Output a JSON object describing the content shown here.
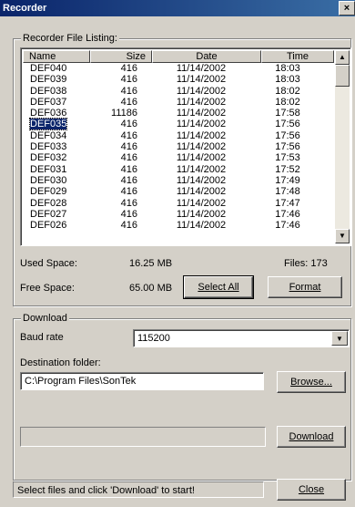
{
  "window": {
    "title": "Recorder",
    "close_glyph": "×"
  },
  "listing": {
    "group_label": "Recorder File Listing:",
    "columns": [
      "Name",
      "Size",
      "Date",
      "Time"
    ],
    "rows": [
      {
        "name": "DEF040",
        "size": "416",
        "date": "11/14/2002",
        "time": "18:03"
      },
      {
        "name": "DEF039",
        "size": "416",
        "date": "11/14/2002",
        "time": "18:03"
      },
      {
        "name": "DEF038",
        "size": "416",
        "date": "11/14/2002",
        "time": "18:02"
      },
      {
        "name": "DEF037",
        "size": "416",
        "date": "11/14/2002",
        "time": "18:02"
      },
      {
        "name": "DEF036",
        "size": "11186",
        "date": "11/14/2002",
        "time": "17:58"
      },
      {
        "name": "DEF035",
        "size": "416",
        "date": "11/14/2002",
        "time": "17:56"
      },
      {
        "name": "DEF034",
        "size": "416",
        "date": "11/14/2002",
        "time": "17:56"
      },
      {
        "name": "DEF033",
        "size": "416",
        "date": "11/14/2002",
        "time": "17:56"
      },
      {
        "name": "DEF032",
        "size": "416",
        "date": "11/14/2002",
        "time": "17:53"
      },
      {
        "name": "DEF031",
        "size": "416",
        "date": "11/14/2002",
        "time": "17:52"
      },
      {
        "name": "DEF030",
        "size": "416",
        "date": "11/14/2002",
        "time": "17:49"
      },
      {
        "name": "DEF029",
        "size": "416",
        "date": "11/14/2002",
        "time": "17:48"
      },
      {
        "name": "DEF028",
        "size": "416",
        "date": "11/14/2002",
        "time": "17:47"
      },
      {
        "name": "DEF027",
        "size": "416",
        "date": "11/14/2002",
        "time": "17:46"
      },
      {
        "name": "DEF026",
        "size": "416",
        "date": "11/14/2002",
        "time": "17:46"
      }
    ],
    "selected_row": "DEF035",
    "scroll_up_glyph": "▲",
    "scroll_down_glyph": "▼",
    "used_space_label": "Used Space:",
    "used_space_value": "16.25 MB",
    "files_label": "Files: 173",
    "free_space_label": "Free Space:",
    "free_space_value": "65.00 MB",
    "select_all_label": "Select All",
    "format_label": "Format"
  },
  "download": {
    "group_label": "Download",
    "baud_label": "Baud rate",
    "baud_value": "115200",
    "dropdown_glyph": "▼",
    "dest_label": "Destination folder:",
    "dest_value": "C:\\Program Files\\SonTek",
    "browse_label": "Browse...",
    "download_label": "Download"
  },
  "footer": {
    "status_text": "Select files and click 'Download' to start!",
    "close_label": "Close"
  }
}
